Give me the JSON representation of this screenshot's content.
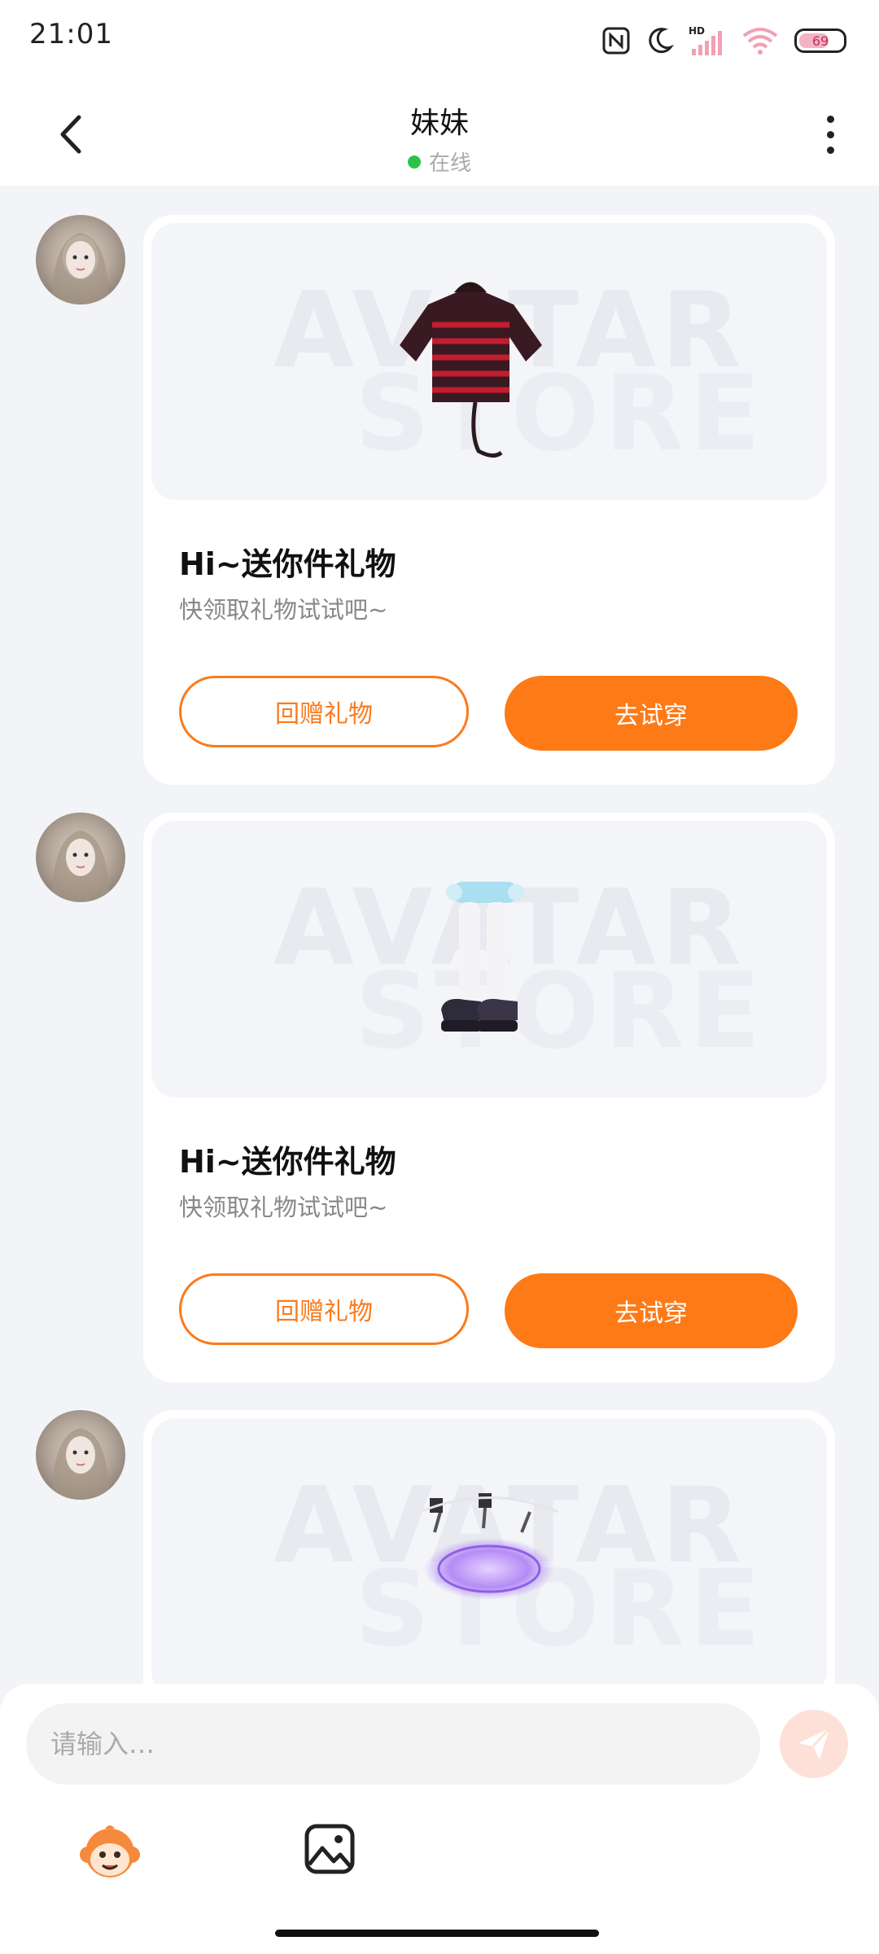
{
  "status_bar": {
    "time": "21:01",
    "battery": "69",
    "icons": [
      "nfc-icon",
      "moon-icon",
      "hd-signal-icon",
      "wifi-icon",
      "battery-icon"
    ]
  },
  "header": {
    "title": "妹妹",
    "status": "在线",
    "status_color": "#2bc24c"
  },
  "messages": [
    {
      "item": "red-black striped hoodie",
      "title": "Hi~送你件礼物",
      "subtitle": "快领取礼物试试吧~",
      "secondary_button": "回赠礼物",
      "primary_button": "去试穿",
      "watermark": [
        "AVATAR",
        "STORE"
      ]
    },
    {
      "item": "socks and platform shoes",
      "title": "Hi~送你件礼物",
      "subtitle": "快领取礼物试试吧~",
      "secondary_button": "回赠礼物",
      "primary_button": "去试穿",
      "watermark": [
        "AVATAR",
        "STORE"
      ]
    },
    {
      "item": "purple magic circle",
      "watermark": [
        "AVATAR",
        "STORE"
      ]
    }
  ],
  "composer": {
    "placeholder": "请输入…",
    "icons": [
      "send-icon",
      "monkey-emoji-icon",
      "image-icon"
    ]
  },
  "colors": {
    "accent": "#fd7a17",
    "background": "#f2f4f7",
    "card": "#ffffff"
  }
}
